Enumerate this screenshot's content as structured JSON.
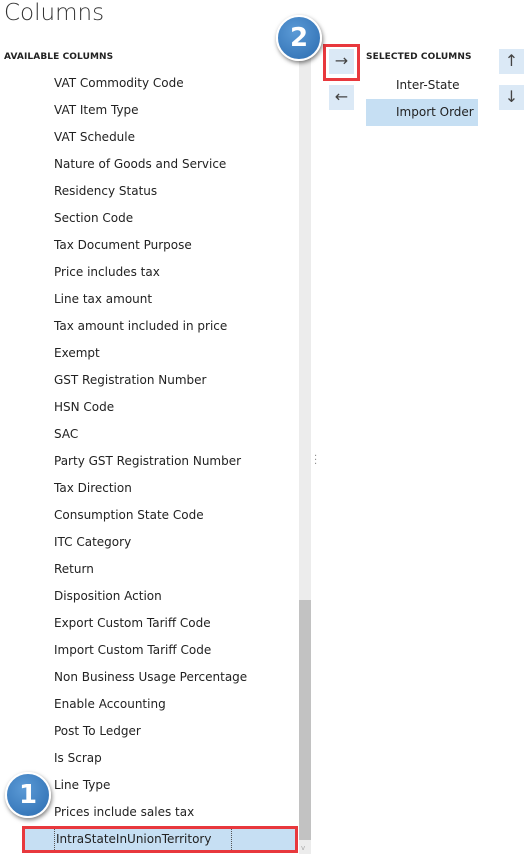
{
  "title": "Columns",
  "available": {
    "header": "AVAILABLE COLUMNS",
    "items": [
      "VAT Commodity Code",
      "VAT Item Type",
      "VAT Schedule",
      "Nature of Goods and Service",
      "Residency Status",
      "Section Code",
      "Tax Document Purpose",
      "Price includes tax",
      "Line tax amount",
      "Tax amount included in price",
      "Exempt",
      "GST Registration Number",
      "HSN Code",
      "SAC",
      "Party GST Registration Number",
      "Tax Direction",
      "Consumption State Code",
      "ITC Category",
      "Return",
      "Disposition Action",
      "Export Custom Tariff Code",
      "Import Custom Tariff Code",
      "Non Business Usage Percentage",
      "Enable Accounting",
      "Post To Ledger",
      "Is Scrap",
      "Line Type",
      "Prices include sales tax"
    ],
    "selected_item": "IntraStateInUnionTerritory"
  },
  "selected": {
    "header": "SELECTED COLUMNS",
    "items": [
      "Inter-State",
      "Import Order"
    ]
  },
  "buttons": {
    "add": "→",
    "remove": "←",
    "up": "↑",
    "down": "↓"
  },
  "badges": {
    "one": "1",
    "two": "2"
  },
  "colors": {
    "highlight": "#c6dff3",
    "callout": "#e8383d",
    "badge": "#2b6cb0"
  }
}
